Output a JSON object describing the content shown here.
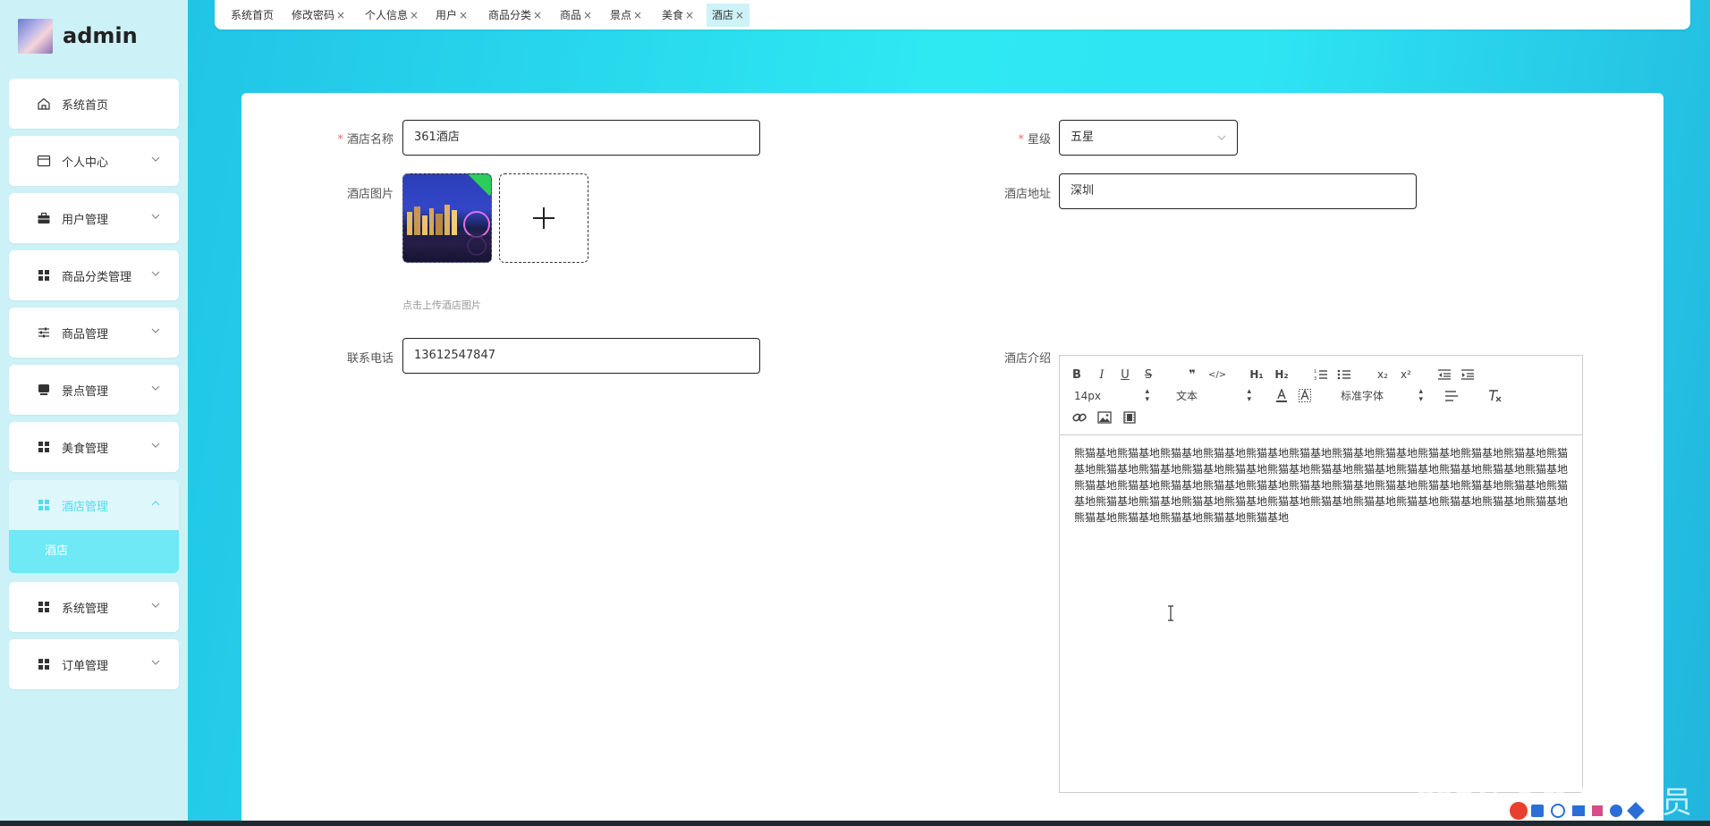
{
  "brand": {
    "name": "admin"
  },
  "sidebar": {
    "items": [
      {
        "label": "系统首页",
        "icon": "home-icon"
      },
      {
        "label": "个人中心",
        "icon": "card-icon"
      },
      {
        "label": "用户管理",
        "icon": "briefcase-icon"
      },
      {
        "label": "商品分类管理",
        "icon": "grid-icon"
      },
      {
        "label": "商品管理",
        "icon": "sliders-icon"
      },
      {
        "label": "景点管理",
        "icon": "monitor-icon"
      },
      {
        "label": "美食管理",
        "icon": "grid-icon"
      },
      {
        "label": "酒店管理",
        "icon": "grid-icon"
      },
      {
        "label": "系统管理",
        "icon": "grid-icon"
      },
      {
        "label": "订单管理",
        "icon": "grid-icon"
      }
    ],
    "active_submenu": "酒店"
  },
  "tabs": [
    {
      "label": "系统首页",
      "closable": false
    },
    {
      "label": "修改密码",
      "closable": true
    },
    {
      "label": "个人信息",
      "closable": true
    },
    {
      "label": "用户",
      "closable": true
    },
    {
      "label": "商品分类",
      "closable": true
    },
    {
      "label": "商品",
      "closable": true
    },
    {
      "label": "景点",
      "closable": true
    },
    {
      "label": "美食",
      "closable": true
    },
    {
      "label": "酒店",
      "closable": true
    }
  ],
  "form": {
    "hotel_name": {
      "label": "酒店名称",
      "value": "361酒店"
    },
    "star": {
      "label": "星级",
      "value": "五星"
    },
    "image": {
      "label": "酒店图片",
      "hint": "点击上传酒店图片"
    },
    "address": {
      "label": "酒店地址",
      "value": "深圳"
    },
    "phone": {
      "label": "联系电话",
      "value": "13612547847"
    },
    "intro": {
      "label": "酒店介绍",
      "font_size": "14px",
      "block_format": "文本",
      "font_family": "标准字体",
      "content": "熊猫基地熊猫基地熊猫基地熊猫基地熊猫基地熊猫基地熊猫基地熊猫基地熊猫基地熊猫基地熊猫基地熊猫基地熊猫基地熊猫基地熊猫基地熊猫基地熊猫基地熊猫基地熊猫基地熊猫基地熊猫基地熊猫基地熊猫基地熊猫基地熊猫基地熊猫基地熊猫基地熊猫基地熊猫基地熊猫基地熊猫基地熊猫基地熊猫基地熊猫基地熊猫基地熊猫基地熊猫基地熊猫基地熊猫基地熊猫基地熊猫基地熊猫基地熊猫基地熊猫基地熊猫基地熊猫基地熊猫基地熊猫基地熊猫基地熊猫基地熊猫基地"
    }
  },
  "watermark": "CSDN @毕业程序员",
  "colors": {
    "accent": "#51dcef",
    "submenu_active": "#6ee9f5",
    "required": "#f56c6c"
  }
}
